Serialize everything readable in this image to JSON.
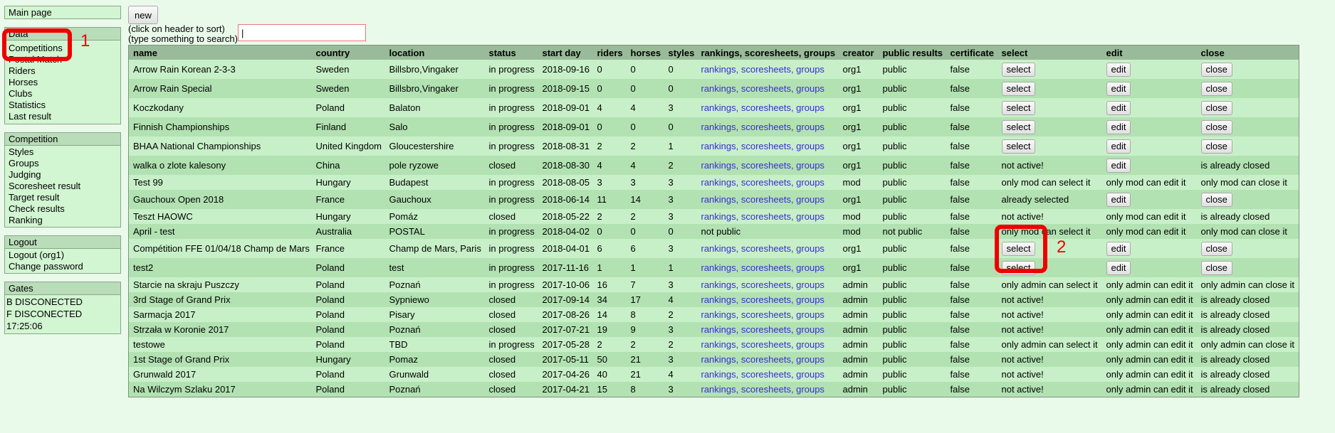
{
  "sidebar": {
    "main_page": "Main page",
    "data_box": {
      "title": "Data",
      "items": [
        "Competitions",
        "Postal Match",
        "Riders",
        "Horses",
        "Clubs",
        "Statistics",
        "Last result"
      ]
    },
    "competition_box": {
      "title": "Competition",
      "items": [
        "Styles",
        "Groups",
        "Judging",
        "Scoresheet result",
        "Target result",
        "Check results",
        "Ranking"
      ]
    },
    "logout_box": {
      "title": "Logout",
      "items": [
        "Logout (org1)",
        "Change password"
      ]
    },
    "gates_box": {
      "title": "Gates",
      "lines": [
        "B DISCONECTED",
        "F DISCONECTED",
        "17:25:06"
      ]
    }
  },
  "toolbar": {
    "new_label": "new",
    "hint_sort": "(click on header to sort)",
    "hint_search": "(type something to search)",
    "search_value": "|"
  },
  "table": {
    "headers": [
      "name",
      "country",
      "location",
      "status",
      "start day",
      "riders",
      "horses",
      "styles",
      "rankings, scoresheets, groups",
      "creator",
      "public results",
      "certificate",
      "select",
      "edit",
      "close"
    ],
    "rows": [
      {
        "name": "Arrow Rain Korean 2-3-3",
        "country": "Sweden",
        "location": "Billsbro,Vingaker",
        "status": "in progress",
        "start": "2018-09-16",
        "riders": "0",
        "horses": "0",
        "styles": "0",
        "links": "rankings, scoresheets, groups",
        "creator": "org1",
        "public": "public",
        "cert": "false",
        "select": "select",
        "edit": "edit",
        "close": "close"
      },
      {
        "name": "Arrow Rain Special",
        "country": "Sweden",
        "location": "Billsbro,Vingaker",
        "status": "in progress",
        "start": "2018-09-15",
        "riders": "0",
        "horses": "0",
        "styles": "0",
        "links": "rankings, scoresheets, groups",
        "creator": "org1",
        "public": "public",
        "cert": "false",
        "select": "select",
        "edit": "edit",
        "close": "close"
      },
      {
        "name": "Koczkodany",
        "country": "Poland",
        "location": "Balaton",
        "status": "in progress",
        "start": "2018-09-01",
        "riders": "4",
        "horses": "4",
        "styles": "3",
        "links": "rankings, scoresheets, groups",
        "creator": "org1",
        "public": "public",
        "cert": "false",
        "select": "select",
        "edit": "edit",
        "close": "close"
      },
      {
        "name": "Finnish Championships",
        "country": "Finland",
        "location": "Salo",
        "status": "in progress",
        "start": "2018-09-01",
        "riders": "0",
        "horses": "0",
        "styles": "0",
        "links": "rankings, scoresheets, groups",
        "creator": "org1",
        "public": "public",
        "cert": "false",
        "select": "select",
        "edit": "edit",
        "close": "close"
      },
      {
        "name": "BHAA National Championships",
        "country": "United Kingdom",
        "location": "Gloucestershire",
        "status": "in progress",
        "start": "2018-08-31",
        "riders": "2",
        "horses": "2",
        "styles": "1",
        "links": "rankings, scoresheets, groups",
        "creator": "org1",
        "public": "public",
        "cert": "false",
        "select": "select",
        "edit": "edit",
        "close": "close"
      },
      {
        "name": "walka o zlote kalesony",
        "country": "China",
        "location": "pole ryzowe",
        "status": "closed",
        "start": "2018-08-30",
        "riders": "4",
        "horses": "4",
        "styles": "2",
        "links": "rankings, scoresheets, groups",
        "creator": "org1",
        "public": "public",
        "cert": "false",
        "select": "not active!",
        "edit": "edit",
        "close": "is already closed"
      },
      {
        "name": "Test 99",
        "country": "Hungary",
        "location": "Budapest",
        "status": "in progress",
        "start": "2018-08-05",
        "riders": "3",
        "horses": "3",
        "styles": "3",
        "links": "rankings, scoresheets, groups",
        "creator": "mod",
        "public": "public",
        "cert": "false",
        "select": "only mod can select it",
        "edit": "only mod can edit it",
        "close": "only mod can close it"
      },
      {
        "name": "Gauchoux Open 2018",
        "country": "France",
        "location": "Gauchoux",
        "status": "in progress",
        "start": "2018-06-14",
        "riders": "11",
        "horses": "14",
        "styles": "3",
        "links": "rankings, scoresheets, groups",
        "creator": "org1",
        "public": "public",
        "cert": "false",
        "select": "already selected",
        "edit": "edit",
        "close": "close"
      },
      {
        "name": "Teszt HAOWC",
        "country": "Hungary",
        "location": "Pomáz",
        "status": "closed",
        "start": "2018-05-22",
        "riders": "2",
        "horses": "2",
        "styles": "3",
        "links": "rankings, scoresheets, groups",
        "creator": "mod",
        "public": "public",
        "cert": "false",
        "select": "not active!",
        "edit": "only mod can edit it",
        "close": "is already closed"
      },
      {
        "name": "April - test",
        "country": "Australia",
        "location": "POSTAL",
        "status": "in progress",
        "start": "2018-04-02",
        "riders": "0",
        "horses": "0",
        "styles": "0",
        "links": "not public",
        "creator": "mod",
        "public": "not public",
        "cert": "false",
        "select": "only mod can select it",
        "edit": "only mod can edit it",
        "close": "only mod can close it"
      },
      {
        "name": "Compétition FFE 01/04/18 Champ de Mars",
        "country": "France",
        "location": "Champ de Mars, Paris",
        "status": "in progress",
        "start": "2018-04-01",
        "riders": "6",
        "horses": "6",
        "styles": "3",
        "links": "rankings, scoresheets, groups",
        "creator": "org1",
        "public": "public",
        "cert": "false",
        "select": "select",
        "edit": "edit",
        "close": "close"
      },
      {
        "name": "test2",
        "country": "Poland",
        "location": "test",
        "status": "in progress",
        "start": "2017-11-16",
        "riders": "1",
        "horses": "1",
        "styles": "1",
        "links": "rankings, scoresheets, groups",
        "creator": "org1",
        "public": "public",
        "cert": "false",
        "select": "select",
        "edit": "edit",
        "close": "close"
      },
      {
        "name": "Starcie na skraju Puszczy",
        "country": "Poland",
        "location": "Poznań",
        "status": "in progress",
        "start": "2017-10-06",
        "riders": "16",
        "horses": "7",
        "styles": "3",
        "links": "rankings, scoresheets, groups",
        "creator": "admin",
        "public": "public",
        "cert": "false",
        "select": "only admin can select it",
        "edit": "only admin can edit it",
        "close": "only admin can close it"
      },
      {
        "name": "3rd Stage of Grand Prix",
        "country": "Poland",
        "location": "Sypniewo",
        "status": "closed",
        "start": "2017-09-14",
        "riders": "34",
        "horses": "17",
        "styles": "4",
        "links": "rankings, scoresheets, groups",
        "creator": "admin",
        "public": "public",
        "cert": "false",
        "select": "not active!",
        "edit": "only admin can edit it",
        "close": "is already closed"
      },
      {
        "name": "Sarmacja 2017",
        "country": "Poland",
        "location": "Pisary",
        "status": "closed",
        "start": "2017-08-26",
        "riders": "14",
        "horses": "8",
        "styles": "2",
        "links": "rankings, scoresheets, groups",
        "creator": "admin",
        "public": "public",
        "cert": "false",
        "select": "not active!",
        "edit": "only admin can edit it",
        "close": "is already closed"
      },
      {
        "name": "Strzała w Koronie 2017",
        "country": "Poland",
        "location": "Poznań",
        "status": "closed",
        "start": "2017-07-21",
        "riders": "19",
        "horses": "9",
        "styles": "3",
        "links": "rankings, scoresheets, groups",
        "creator": "admin",
        "public": "public",
        "cert": "false",
        "select": "not active!",
        "edit": "only admin can edit it",
        "close": "is already closed"
      },
      {
        "name": "testowe",
        "country": "Poland",
        "location": "TBD",
        "status": "in progress",
        "start": "2017-05-28",
        "riders": "2",
        "horses": "2",
        "styles": "2",
        "links": "rankings, scoresheets, groups",
        "creator": "admin",
        "public": "public",
        "cert": "false",
        "select": "only admin can select it",
        "edit": "only admin can edit it",
        "close": "only admin can close it"
      },
      {
        "name": "1st Stage of Grand Prix",
        "country": "Hungary",
        "location": "Pomaz",
        "status": "closed",
        "start": "2017-05-11",
        "riders": "50",
        "horses": "21",
        "styles": "3",
        "links": "rankings, scoresheets, groups",
        "creator": "admin",
        "public": "public",
        "cert": "false",
        "select": "not active!",
        "edit": "only admin can edit it",
        "close": "is already closed"
      },
      {
        "name": "Grunwald 2017",
        "country": "Poland",
        "location": "Grunwald",
        "status": "closed",
        "start": "2017-04-26",
        "riders": "40",
        "horses": "21",
        "styles": "4",
        "links": "rankings, scoresheets, groups",
        "creator": "admin",
        "public": "public",
        "cert": "false",
        "select": "not active!",
        "edit": "only admin can edit it",
        "close": "is already closed"
      },
      {
        "name": "Na Wilczym Szlaku 2017",
        "country": "Poland",
        "location": "Poznań",
        "status": "closed",
        "start": "2017-04-21",
        "riders": "15",
        "horses": "8",
        "styles": "3",
        "links": "rankings, scoresheets, groups",
        "creator": "admin",
        "public": "public",
        "cert": "false",
        "select": "not active!",
        "edit": "only admin can edit it",
        "close": "is already closed"
      }
    ]
  },
  "annotations": {
    "color": "#e00000",
    "label_1": "1",
    "label_2": "2"
  }
}
